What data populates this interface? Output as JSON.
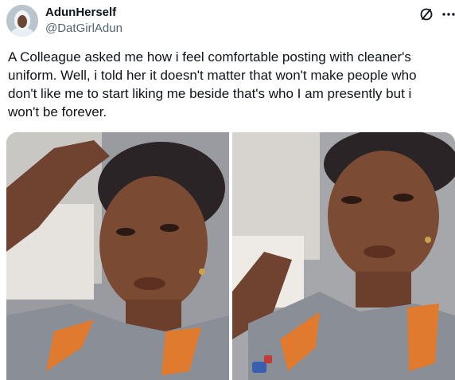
{
  "author": {
    "display_name": "AdunHerself",
    "handle": "@DatGirlAdun",
    "avatar_icon": "profile-avatar"
  },
  "header_actions": {
    "grok_icon": "grok-icon",
    "more_icon": "more-horizontal-icon"
  },
  "tweet": {
    "text": "A Colleague asked me how i feel comfortable posting with cleaner's uniform. Well, i told her it doesn't matter that won't make people who don't like me to start liking me beside that's who I am presently but i won't be forever."
  },
  "media": {
    "photos": [
      {
        "subject": "selfie-hand-on-head"
      },
      {
        "subject": "selfie-close-up"
      }
    ]
  },
  "colors": {
    "text_primary": "#0f1419",
    "text_secondary": "#536471",
    "uniform_grey": "#8a8e97",
    "uniform_orange": "#e07a2e",
    "skin": "#7a4a32",
    "headwrap": "#2a2426"
  }
}
